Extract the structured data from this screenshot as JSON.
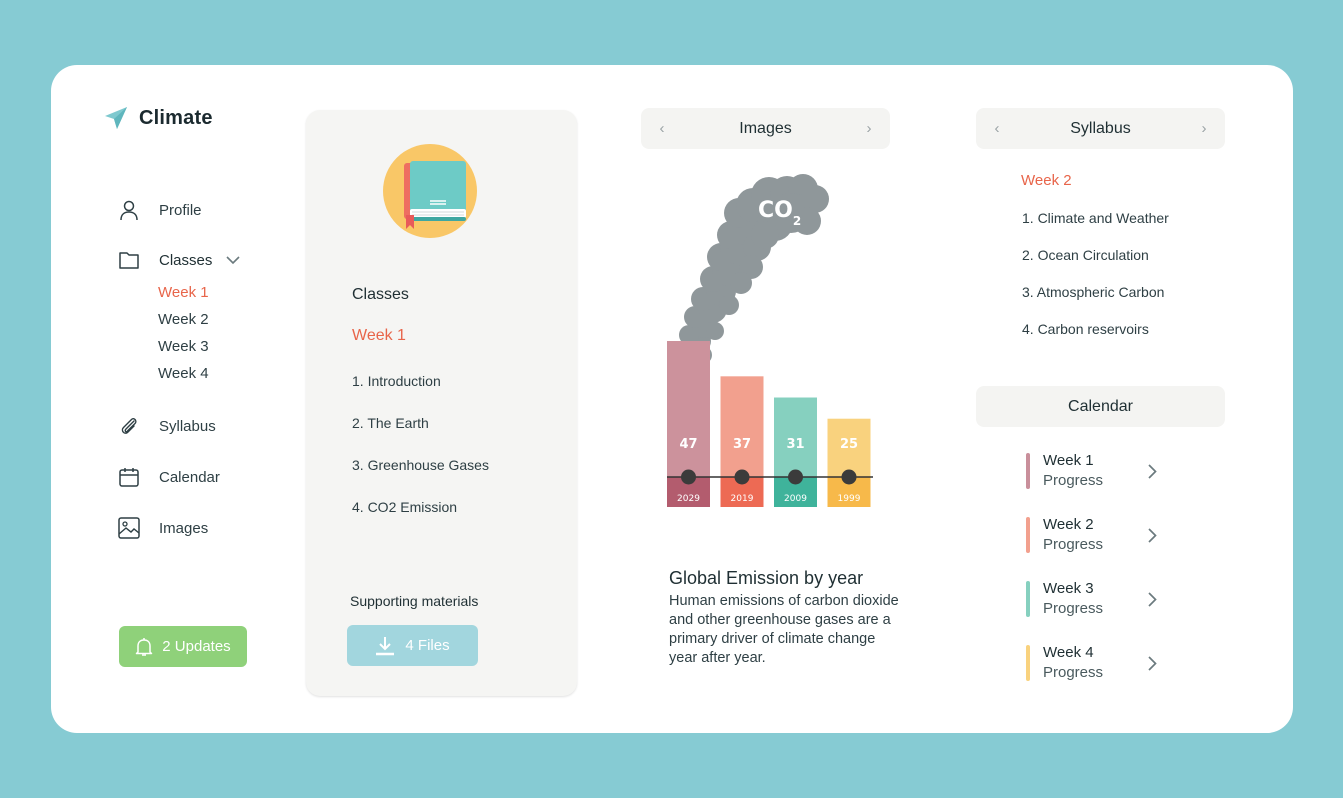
{
  "app": {
    "title": "Climate"
  },
  "sidebar": {
    "items": [
      {
        "label": "Profile",
        "icon": "user-icon"
      },
      {
        "label": "Classes",
        "icon": "folder-icon"
      },
      {
        "label": "Syllabus",
        "icon": "paperclip-icon"
      },
      {
        "label": "Calendar",
        "icon": "calendar-icon"
      },
      {
        "label": "Images",
        "icon": "image-icon"
      }
    ],
    "class_weeks": [
      "Week 1",
      "Week 2",
      "Week 3",
      "Week 4"
    ],
    "active_week": "Week 1",
    "updates_label": "2 Updates"
  },
  "classes_panel": {
    "title": "Classes",
    "week": "Week 1",
    "topics": [
      "1. Introduction",
      "2. The Earth",
      "3. Greenhouse Gases",
      "4. CO2 Emission"
    ],
    "supporting_label": "Supporting materials",
    "files_label": "4 Files"
  },
  "images": {
    "header": "Images",
    "smoke_label": "CO",
    "smoke_sub": "2",
    "caption_title": "Global Emission by year",
    "caption_text": "Human emissions of carbon dioxide and other greenhouse gases are a primary driver of climate change year after year."
  },
  "chart_data": {
    "type": "bar",
    "categories": [
      "2029",
      "2019",
      "2009",
      "1999"
    ],
    "values": [
      47,
      37,
      31,
      25
    ],
    "colors": [
      "#cc929c",
      "#f2a08e",
      "#86d0bf",
      "#f9d27e"
    ],
    "base_colors": [
      "#b35c6e",
      "#ed6a54",
      "#3fb39b",
      "#f7b94a"
    ]
  },
  "syllabus": {
    "header": "Syllabus",
    "week": "Week 2",
    "topics": [
      "1. Climate and Weather",
      "2. Ocean Circulation",
      "3. Atmospheric Carbon",
      "4. Carbon reservoirs"
    ]
  },
  "calendar": {
    "header": "Calendar",
    "items": [
      {
        "week": "Week 1",
        "status": "Progress",
        "color": "#c98f9b"
      },
      {
        "week": "Week 2",
        "status": "Progress",
        "color": "#f2a08e"
      },
      {
        "week": "Week 3",
        "status": "Progress",
        "color": "#86d0bf"
      },
      {
        "week": "Week 4",
        "status": "Progress",
        "color": "#f9d27e"
      }
    ]
  },
  "colors": {
    "accent": "#e8654a",
    "background": "#86cbd3",
    "updates": "#8fd17a",
    "files": "#a2d6de"
  }
}
